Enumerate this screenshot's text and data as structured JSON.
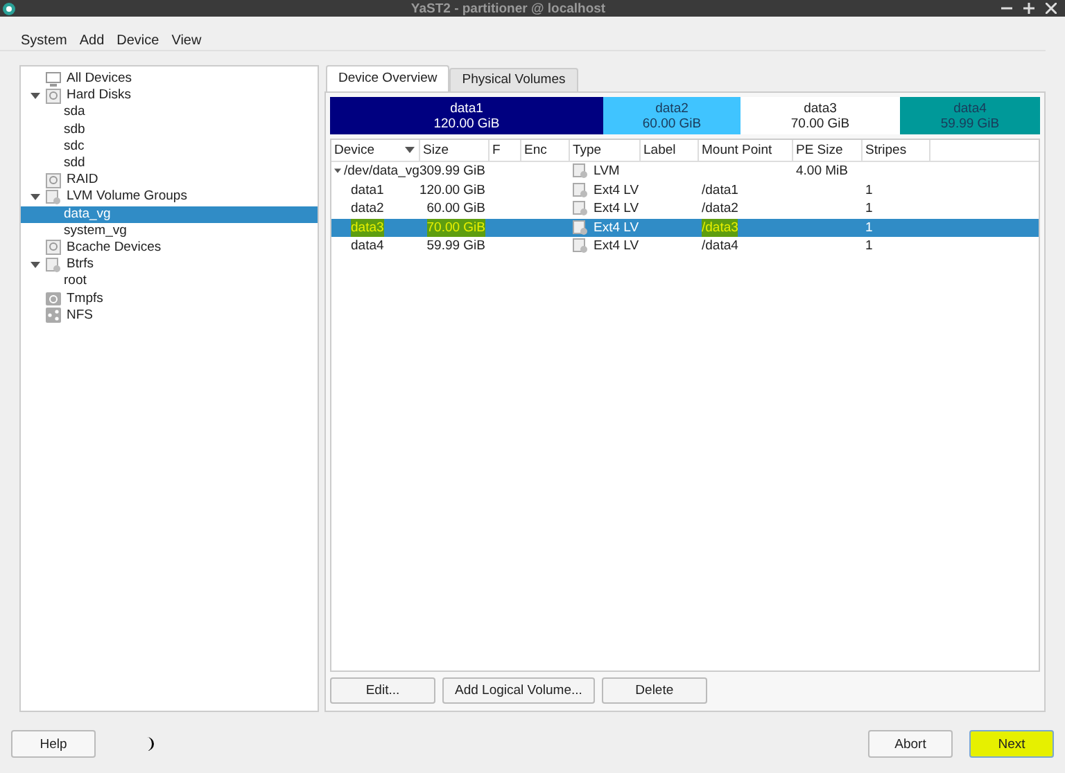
{
  "window": {
    "title": "YaST2 - partitioner @ localhost"
  },
  "menu": [
    "System",
    "Add",
    "Device",
    "View"
  ],
  "tree": [
    {
      "label": "All Devices",
      "kind": "monitor",
      "selected": false
    },
    {
      "label": "Hard Disks",
      "kind": "disk",
      "expanded": true,
      "selected": false,
      "children": [
        {
          "label": "sda",
          "selected": false
        },
        {
          "label": "sdb",
          "selected": false
        },
        {
          "label": "sdc",
          "selected": false
        },
        {
          "label": "sdd",
          "selected": false
        }
      ]
    },
    {
      "label": "RAID",
      "kind": "disk",
      "selected": false
    },
    {
      "label": "LVM Volume Groups",
      "kind": "lvm",
      "expanded": true,
      "selected": false,
      "children": [
        {
          "label": "data_vg",
          "selected": true
        },
        {
          "label": "system_vg",
          "selected": false
        }
      ]
    },
    {
      "label": "Bcache Devices",
      "kind": "disk",
      "selected": false
    },
    {
      "label": "Btrfs",
      "kind": "lvm",
      "expanded": true,
      "selected": false,
      "children": [
        {
          "label": "root",
          "selected": false
        }
      ]
    },
    {
      "label": "Tmpfs",
      "kind": "folder",
      "selected": false
    },
    {
      "label": "NFS",
      "kind": "share",
      "selected": false
    }
  ],
  "tabs": [
    {
      "label": "Device Overview",
      "selected": true
    },
    {
      "label": "Physical Volumes",
      "selected": false
    }
  ],
  "bar": [
    {
      "name": "data1",
      "size": "120.00 GiB",
      "color": "#000080"
    },
    {
      "name": "data2",
      "size": "60.00 GiB",
      "color": "#40c4ff"
    },
    {
      "name": "data3",
      "size": "70.00 GiB",
      "color": "#ffffff"
    },
    {
      "name": "data4",
      "size": "59.99 GiB",
      "color": "#009999"
    }
  ],
  "table": {
    "columns": [
      "Device",
      "Size",
      "F",
      "Enc",
      "Type",
      "Label",
      "Mount Point",
      "PE Size",
      "Stripes"
    ],
    "rows": [
      {
        "device": "/dev/data_vg",
        "size": "309.99 GiB",
        "type": "LVM",
        "mount_point": "",
        "pe_size": "4.00 MiB",
        "stripes": "",
        "expanded": true,
        "selected": false,
        "highlighted": false
      },
      {
        "device": "data1",
        "size": "120.00 GiB",
        "type": "Ext4 LV",
        "mount_point": "/data1",
        "pe_size": "",
        "stripes": "1",
        "selected": false,
        "highlighted": false
      },
      {
        "device": "data2",
        "size": "60.00 GiB",
        "type": "Ext4 LV",
        "mount_point": "/data2",
        "pe_size": "",
        "stripes": "1",
        "selected": false,
        "highlighted": false
      },
      {
        "device": "data3",
        "size": "70.00 GiB",
        "type": "Ext4 LV",
        "mount_point": "/data3",
        "pe_size": "",
        "stripes": "1",
        "selected": true,
        "highlighted": true
      },
      {
        "device": "data4",
        "size": "59.99 GiB",
        "type": "Ext4 LV",
        "mount_point": "/data4",
        "pe_size": "",
        "stripes": "1",
        "selected": false,
        "highlighted": false
      }
    ]
  },
  "actions": [
    "Edit...",
    "Add Logical Volume...",
    "Delete"
  ],
  "footer": {
    "help": "Help",
    "abort": "Abort",
    "next": {
      "label": "Next",
      "highlighted": true
    }
  }
}
